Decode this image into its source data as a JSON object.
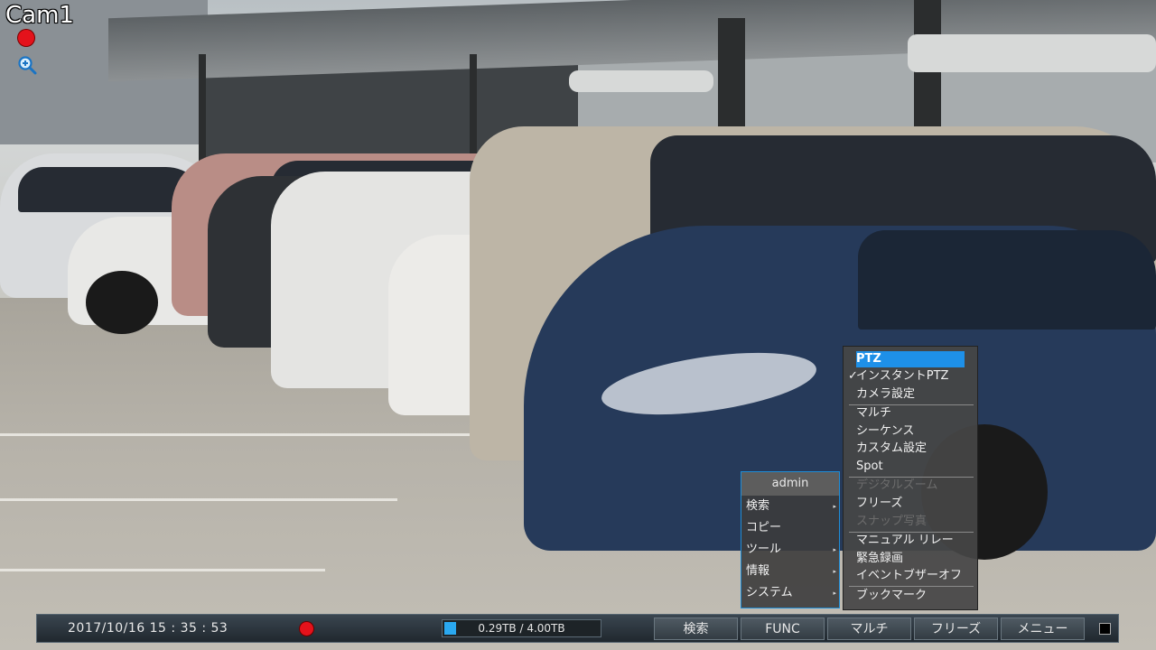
{
  "camera": {
    "title": "Cam1"
  },
  "submenu": {
    "items": [
      {
        "label": "PTZ",
        "state": "selected"
      },
      {
        "label": "インスタントPTZ",
        "checked": true
      },
      {
        "label": "カメラ設定"
      },
      {
        "label": "マルチ"
      },
      {
        "label": "シーケンス"
      },
      {
        "label": "カスタム設定"
      },
      {
        "label": "Spot"
      },
      {
        "label": "デジタルズーム",
        "state": "disabled"
      },
      {
        "label": "フリーズ"
      },
      {
        "label": "スナップ写真",
        "state": "disabled"
      },
      {
        "label": "マニュアル リレー"
      },
      {
        "label": "緊急録画"
      },
      {
        "label": "イベントブザーオフ"
      },
      {
        "label": "ブックマーク"
      }
    ],
    "check_mark": "✓"
  },
  "main_menu": {
    "user": "admin",
    "items": [
      {
        "label": "検索",
        "has_submenu": true
      },
      {
        "label": "コピー",
        "has_submenu": false
      },
      {
        "label": "ツール",
        "has_submenu": true
      },
      {
        "label": "情報",
        "has_submenu": true
      },
      {
        "label": "システム",
        "has_submenu": true
      }
    ],
    "arrow": "▸"
  },
  "status_bar": {
    "datetime": "2017/10/16  15 : 35 : 53",
    "storage": {
      "text": "0.29TB / 4.00TB",
      "used_fraction": 0.0725
    },
    "buttons": [
      "検索",
      "FUNC",
      "マルチ",
      "フリーズ",
      "メニュー"
    ]
  },
  "colors": {
    "accent": "#1e90e8",
    "record": "#e4121b"
  }
}
